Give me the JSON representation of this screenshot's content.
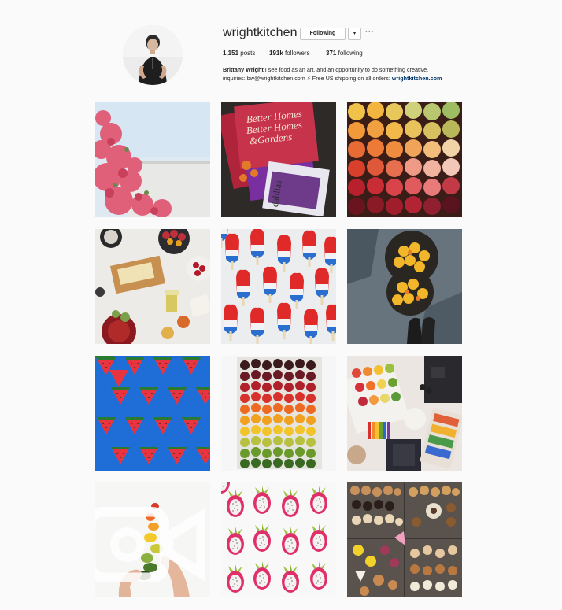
{
  "profile": {
    "username": "wrightkitchen",
    "follow_button": "Following",
    "dropdown_glyph": "▾",
    "more_glyph": "···",
    "posts_count": "1,151",
    "posts_label": "posts",
    "followers_count": "191k",
    "followers_label": "followers",
    "following_count": "371",
    "following_label": "following",
    "full_name": "Brittany Wright",
    "bio_line1": " I see food as an art, and an opportunity to do something creative.",
    "bio_line2": "inquiries: bw@wrightkitchen.com ⚡ Free US shipping on all orders: ",
    "website": "wrightkitchen.com"
  },
  "posts": [
    {
      "subject": "pink bougainvillea against sky"
    },
    {
      "subject": "stacked magazines Better Homes & Gardens"
    },
    {
      "subject": "rainbow of stone fruits"
    },
    {
      "subject": "cheese and fruit platter flatlay"
    },
    {
      "subject": "red white and blue popsicles"
    },
    {
      "subject": "bowls of apricots on stone"
    },
    {
      "subject": "watermelon triangles on blue"
    },
    {
      "subject": "rainbow of cherry tomatoes in tray"
    },
    {
      "subject": "citrus slices and color swatches flatlay"
    },
    {
      "subject": "hands arranging peppers (video)"
    },
    {
      "subject": "dragon fruit halves"
    },
    {
      "subject": "pastry and cookie assortment"
    }
  ],
  "icons": {
    "video": "video-camera-icon"
  },
  "colors": {
    "background": "#fafafa",
    "text": "#262626",
    "link": "#003569",
    "border": "#c7c7c7"
  }
}
